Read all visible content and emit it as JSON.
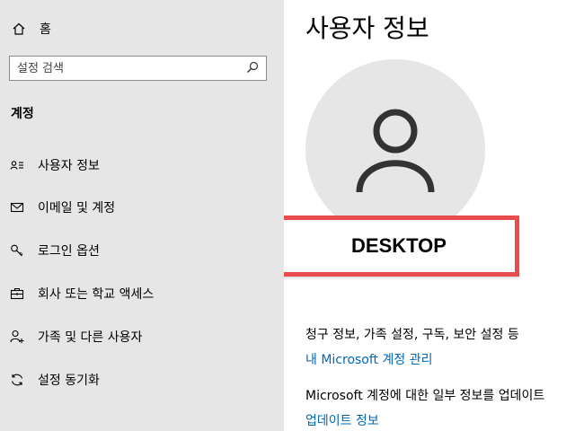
{
  "sidebar": {
    "home_label": "홈",
    "search_placeholder": "설정 검색",
    "section_title": "계정",
    "items": [
      {
        "label": "사용자 정보",
        "icon": "user-info-icon"
      },
      {
        "label": "이메일 및 계정",
        "icon": "mail-icon"
      },
      {
        "label": "로그인 옵션",
        "icon": "key-icon"
      },
      {
        "label": "회사 또는 학교 액세스",
        "icon": "briefcase-icon"
      },
      {
        "label": "가족 및 다른 사용자",
        "icon": "add-user-icon"
      },
      {
        "label": "설정 동기화",
        "icon": "sync-icon"
      }
    ]
  },
  "main": {
    "title": "사용자 정보",
    "account_name": "DESKTOP",
    "info_text_1": "청구 정보, 가족 설정, 구독, 보안 설정 등",
    "link_1": "내 Microsoft 계정 관리",
    "info_text_2": "Microsoft 계정에 대한 일부 정보를 업데이트",
    "link_2": "업데이트 정보"
  },
  "colors": {
    "sidebar_bg": "#e6e6e6",
    "link": "#0067b8",
    "highlight": "#e84c4c"
  }
}
